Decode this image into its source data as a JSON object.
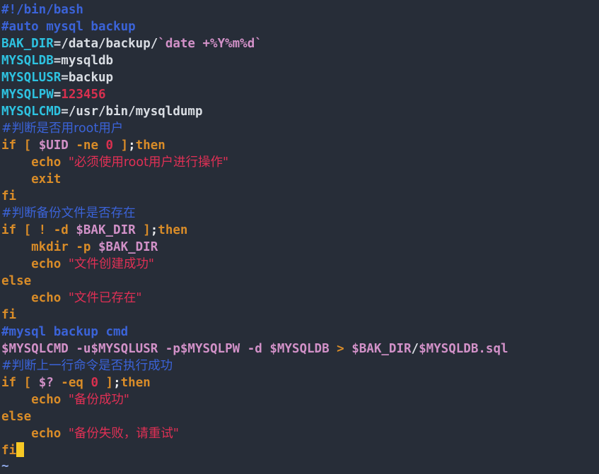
{
  "app": {
    "kind": "terminal-text-editor",
    "filetype": "sh",
    "background_color": "#272d38",
    "cursor_color": "#f7c825"
  },
  "palette": {
    "comment": "#3b63d8",
    "variable_name": "#2ec2e0",
    "plain_text": "#d9dde3",
    "substitution": "#d291c8",
    "number": "#d9304f",
    "keyword": "#d98c28",
    "string": "#e03055",
    "punctuation": "#e8eaed",
    "tilde": "#8fa9e8"
  },
  "code": {
    "lines": [
      {
        "n": 1,
        "tokens": [
          {
            "t": "#!/bin/bash",
            "c": "cmt"
          }
        ]
      },
      {
        "n": 2,
        "tokens": [
          {
            "t": "#auto mysql backup",
            "c": "cmt"
          }
        ]
      },
      {
        "n": 3,
        "tokens": [
          {
            "t": "BAK_DIR",
            "c": "var"
          },
          {
            "t": "=/data/backup/",
            "c": "plain"
          },
          {
            "t": "`date +%Y%m%d`",
            "c": "subst"
          }
        ]
      },
      {
        "n": 4,
        "tokens": [
          {
            "t": "MYSQLDB",
            "c": "var"
          },
          {
            "t": "=mysqldb",
            "c": "plain"
          }
        ]
      },
      {
        "n": 5,
        "tokens": [
          {
            "t": "MYSQLUSR",
            "c": "var"
          },
          {
            "t": "=backup",
            "c": "plain"
          }
        ]
      },
      {
        "n": 6,
        "tokens": [
          {
            "t": "MYSQLPW",
            "c": "var"
          },
          {
            "t": "=",
            "c": "plain"
          },
          {
            "t": "123456",
            "c": "num"
          }
        ]
      },
      {
        "n": 7,
        "tokens": [
          {
            "t": "MYSQLCMD",
            "c": "var"
          },
          {
            "t": "=/usr/bin/mysqldump",
            "c": "plain"
          }
        ]
      },
      {
        "n": 8,
        "tokens": [
          {
            "t": "#判断是否用root用户",
            "c": "cmt"
          }
        ]
      },
      {
        "n": 9,
        "tokens": [
          {
            "t": "if [ ",
            "c": "kw"
          },
          {
            "t": "$UID",
            "c": "subst"
          },
          {
            "t": " -ne ",
            "c": "kw"
          },
          {
            "t": "0",
            "c": "num"
          },
          {
            "t": " ]",
            "c": "kw"
          },
          {
            "t": ";",
            "c": "punct"
          },
          {
            "t": "then",
            "c": "kw"
          }
        ]
      },
      {
        "n": 10,
        "tokens": [
          {
            "t": "    echo ",
            "c": "kw"
          },
          {
            "t": "\"必须使用root用户进行操作\"",
            "c": "str"
          }
        ]
      },
      {
        "n": 11,
        "tokens": [
          {
            "t": "    exit",
            "c": "kw"
          }
        ]
      },
      {
        "n": 12,
        "tokens": [
          {
            "t": "fi",
            "c": "kw"
          }
        ]
      },
      {
        "n": 13,
        "tokens": [
          {
            "t": "#判断备份文件是否存在",
            "c": "cmt"
          }
        ]
      },
      {
        "n": 14,
        "tokens": [
          {
            "t": "if [ ! -d ",
            "c": "kw"
          },
          {
            "t": "$BAK_DIR",
            "c": "subst"
          },
          {
            "t": " ]",
            "c": "kw"
          },
          {
            "t": ";",
            "c": "punct"
          },
          {
            "t": "then",
            "c": "kw"
          }
        ]
      },
      {
        "n": 15,
        "tokens": [
          {
            "t": "    mkdir -p ",
            "c": "kw"
          },
          {
            "t": "$BAK_DIR",
            "c": "subst"
          }
        ]
      },
      {
        "n": 16,
        "tokens": [
          {
            "t": "    echo ",
            "c": "kw"
          },
          {
            "t": "\"文件创建成功\"",
            "c": "str"
          }
        ]
      },
      {
        "n": 17,
        "tokens": [
          {
            "t": "else",
            "c": "kw"
          }
        ]
      },
      {
        "n": 18,
        "tokens": [
          {
            "t": "    echo ",
            "c": "kw"
          },
          {
            "t": "\"文件已存在\"",
            "c": "str"
          }
        ]
      },
      {
        "n": 19,
        "tokens": [
          {
            "t": "fi",
            "c": "kw"
          }
        ]
      },
      {
        "n": 20,
        "tokens": [
          {
            "t": "#mysql backup cmd",
            "c": "cmt"
          }
        ]
      },
      {
        "n": 21,
        "tokens": [
          {
            "t": "$MYSQLCMD",
            "c": "subst"
          },
          {
            "t": " -u",
            "c": "subst"
          },
          {
            "t": "$MYSQLUSR",
            "c": "subst"
          },
          {
            "t": " -p",
            "c": "subst"
          },
          {
            "t": "$MYSQLPW",
            "c": "subst"
          },
          {
            "t": " -d ",
            "c": "subst"
          },
          {
            "t": "$MYSQLDB",
            "c": "subst"
          },
          {
            "t": " > ",
            "c": "kw"
          },
          {
            "t": "$BAK_DIR",
            "c": "subst"
          },
          {
            "t": "/",
            "c": "plain"
          },
          {
            "t": "$MYSQLDB",
            "c": "subst"
          },
          {
            "t": ".sql",
            "c": "subst"
          }
        ]
      },
      {
        "n": 22,
        "tokens": [
          {
            "t": "#判断上一行命令是否执行成功",
            "c": "cmt"
          }
        ]
      },
      {
        "n": 23,
        "tokens": [
          {
            "t": "if [ ",
            "c": "kw"
          },
          {
            "t": "$?",
            "c": "subst"
          },
          {
            "t": " -eq ",
            "c": "kw"
          },
          {
            "t": "0",
            "c": "num"
          },
          {
            "t": " ]",
            "c": "kw"
          },
          {
            "t": ";",
            "c": "punct"
          },
          {
            "t": "then",
            "c": "kw"
          }
        ]
      },
      {
        "n": 24,
        "tokens": [
          {
            "t": "    echo ",
            "c": "kw"
          },
          {
            "t": "\"备份成功\"",
            "c": "str"
          }
        ]
      },
      {
        "n": 25,
        "tokens": [
          {
            "t": "else",
            "c": "kw"
          }
        ]
      },
      {
        "n": 26,
        "tokens": [
          {
            "t": "    echo ",
            "c": "kw"
          },
          {
            "t": "\"备份失败，请重试\"",
            "c": "str"
          }
        ]
      },
      {
        "n": 27,
        "tokens": [
          {
            "t": "fi",
            "c": "kw"
          },
          {
            "t": " ",
            "c": "cursor"
          }
        ]
      }
    ]
  },
  "empty_line_markers": {
    "symbol": "~",
    "count": 1
  }
}
